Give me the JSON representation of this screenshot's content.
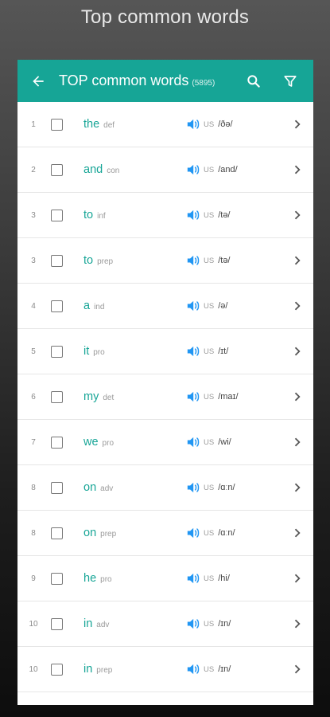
{
  "caption": "Top common words",
  "appbar": {
    "title": "TOP common words",
    "count": "(5895)",
    "back_icon": "arrow-back-icon",
    "search_icon": "search-icon",
    "filter_icon": "filter-icon"
  },
  "colors": {
    "accent": "#16a596",
    "speaker": "#2196f3"
  },
  "locale_label": "US",
  "words": [
    {
      "rank": "1",
      "word": "the",
      "pos": "def",
      "ipa": "/ðə/"
    },
    {
      "rank": "2",
      "word": "and",
      "pos": "con",
      "ipa": "/and/"
    },
    {
      "rank": "3",
      "word": "to",
      "pos": "inf",
      "ipa": "/tə/"
    },
    {
      "rank": "3",
      "word": "to",
      "pos": "prep",
      "ipa": "/tə/"
    },
    {
      "rank": "4",
      "word": "a",
      "pos": "ind",
      "ipa": "/ə/"
    },
    {
      "rank": "5",
      "word": "it",
      "pos": "pro",
      "ipa": "/ɪt/"
    },
    {
      "rank": "6",
      "word": "my",
      "pos": "det",
      "ipa": "/maɪ/"
    },
    {
      "rank": "7",
      "word": "we",
      "pos": "pro",
      "ipa": "/wi/"
    },
    {
      "rank": "8",
      "word": "on",
      "pos": "adv",
      "ipa": "/ɑːn/"
    },
    {
      "rank": "8",
      "word": "on",
      "pos": "prep",
      "ipa": "/ɑːn/"
    },
    {
      "rank": "9",
      "word": "he",
      "pos": "pro",
      "ipa": "/hi/"
    },
    {
      "rank": "10",
      "word": "in",
      "pos": "adv",
      "ipa": "/ɪn/"
    },
    {
      "rank": "10",
      "word": "in",
      "pos": "prep",
      "ipa": "/ɪn/"
    }
  ]
}
